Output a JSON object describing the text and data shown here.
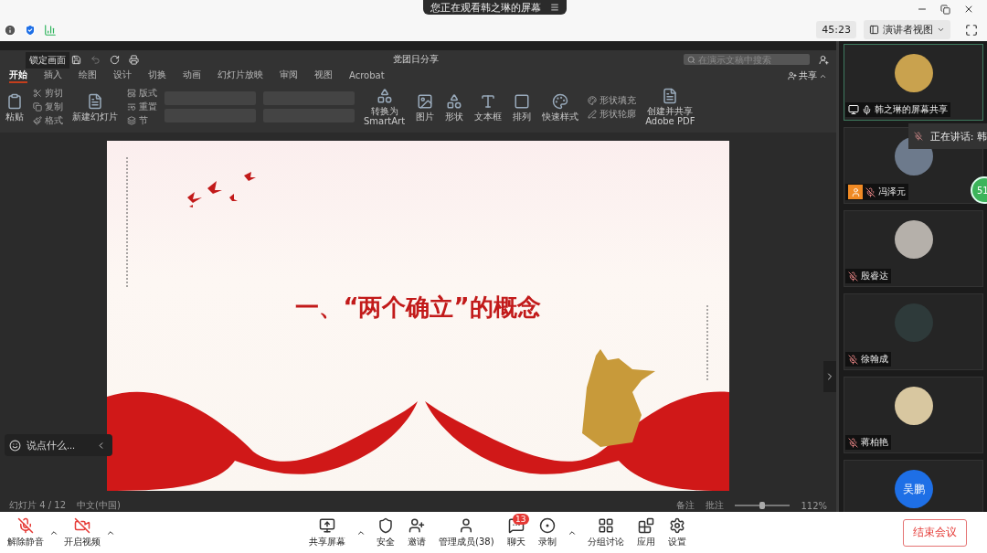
{
  "top_bar": {
    "banner": "您正在观看韩之琳的屏幕",
    "timer": "45:23",
    "view_button": "演讲者视图"
  },
  "ppt": {
    "lock_label": "锁定画面",
    "doc_title": "党团日分享",
    "search": {
      "placeholder": "在演示文稿中搜索"
    },
    "share": "共享",
    "tabs": [
      {
        "label": "开始",
        "selected": true
      },
      {
        "label": "插入",
        "selected": false
      },
      {
        "label": "绘图",
        "selected": false
      },
      {
        "label": "设计",
        "selected": false
      },
      {
        "label": "切换",
        "selected": false
      },
      {
        "label": "动画",
        "selected": false
      },
      {
        "label": "幻灯片放映",
        "selected": false
      },
      {
        "label": "审阅",
        "selected": false
      },
      {
        "label": "视图",
        "selected": false
      },
      {
        "label": "Acrobat",
        "selected": false
      }
    ],
    "ribbon": [
      {
        "kind": "large",
        "label": "粘贴"
      },
      {
        "kind": "small",
        "items": [
          "剪切",
          "复制",
          "格式"
        ]
      },
      {
        "kind": "large",
        "label": "新建幻灯片"
      },
      {
        "kind": "small",
        "items": [
          "版式",
          "重置",
          "节"
        ]
      },
      {
        "kind": "format"
      },
      {
        "kind": "format"
      },
      {
        "kind": "large",
        "label": "转换为\nSmartArt"
      },
      {
        "kind": "large",
        "label": "图片"
      },
      {
        "kind": "large",
        "label": "形状"
      },
      {
        "kind": "large",
        "label": "文本框"
      },
      {
        "kind": "large",
        "label": "排列"
      },
      {
        "kind": "large",
        "label": "快速样式"
      },
      {
        "kind": "small",
        "items": [
          "形状填充",
          "形状轮廓"
        ]
      },
      {
        "kind": "large",
        "label": "创建并共享\nAdobe PDF"
      }
    ],
    "slide": {
      "title": "一、“两个确立”的概念"
    },
    "status": {
      "slide": "幻灯片 4 / 12",
      "language": "中文(中国)",
      "notes": "备注",
      "comments": "批注",
      "zoom": "112%",
      "zoom_slider": {
        "level": 0.5
      }
    }
  },
  "chat": {
    "placeholder": "说点什么..."
  },
  "participants": [
    {
      "kind": "share",
      "name": "韩之琳的屏幕共享",
      "muted": false
    },
    {
      "kind": "host",
      "name": "冯泽元",
      "muted": true
    },
    {
      "kind": "member",
      "name": "殷睿达",
      "muted": true
    },
    {
      "kind": "member",
      "name": "徐翰成",
      "muted": true
    },
    {
      "kind": "member",
      "name": "蒋柏艳",
      "muted": true
    },
    {
      "kind": "text",
      "avatar_text": "吴鹏"
    }
  ],
  "speaking": "正在讲话: 韩",
  "side_badge": "51",
  "toolbar": {
    "left": [
      {
        "label": "解除静音",
        "off": true
      },
      {
        "label": "开启视频",
        "off": true
      }
    ],
    "center": [
      {
        "label": "共享屏幕",
        "menu": true
      },
      {
        "label": "安全",
        "menu": false
      },
      {
        "label": "邀请",
        "menu": false
      },
      {
        "label": "管理成员(38)",
        "menu": false
      },
      {
        "label": "聊天",
        "menu": false,
        "badge": "13"
      },
      {
        "label": "录制",
        "menu": true
      },
      {
        "label": "分组讨论",
        "menu": false
      },
      {
        "label": "应用",
        "menu": false
      },
      {
        "label": "设置",
        "menu": false
      }
    ],
    "end_button": "结束会议"
  }
}
